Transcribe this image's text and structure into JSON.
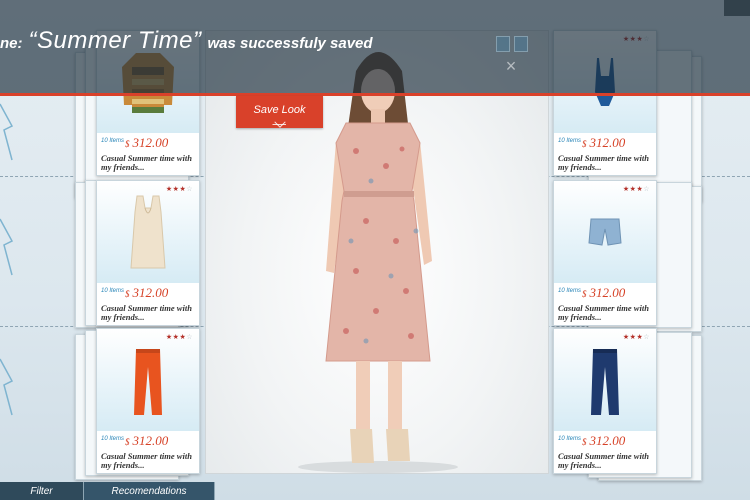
{
  "toast": {
    "prefix": "ne:",
    "look_name": "“Summer Time”",
    "message": "was successfuly saved"
  },
  "save_button": {
    "label": "Save Look"
  },
  "tabs": [
    {
      "label": "Filter"
    },
    {
      "label": "Recomendations"
    }
  ],
  "cards": {
    "left": [
      {
        "items": "10 Items",
        "currency": "$",
        "price": "312.00",
        "desc": "Casual Summer time with my friends...",
        "product": "patterned sweater",
        "rating": 0
      },
      {
        "items": "10 Items",
        "currency": "$",
        "price": "312.00",
        "desc": "Casual Summer time with my friends...",
        "product": "cream sleeveless top",
        "rating": 3
      },
      {
        "items": "10 Items",
        "currency": "$",
        "price": "312.00",
        "desc": "Casual Summer time with my friends...",
        "product": "orange pants",
        "rating": 3
      }
    ],
    "right": [
      {
        "items": "10 Items",
        "currency": "$",
        "price": "312.00",
        "desc": "Casual Summer time with my friends...",
        "product": "blue swimsuit",
        "rating": 3
      },
      {
        "items": "10 Items",
        "currency": "$",
        "price": "312.00",
        "desc": "Casual Summer time with my friends...",
        "product": "denim shorts",
        "rating": 3
      },
      {
        "items": "10 Items",
        "currency": "$",
        "price": "312.00",
        "desc": "Casual Summer time with my friends...",
        "product": "navy jeans",
        "rating": 3
      }
    ]
  },
  "colors": {
    "accent": "#d9412a",
    "price": "#d64126",
    "overlay": "#1a2c3a",
    "tab": "#2f4a5b"
  }
}
